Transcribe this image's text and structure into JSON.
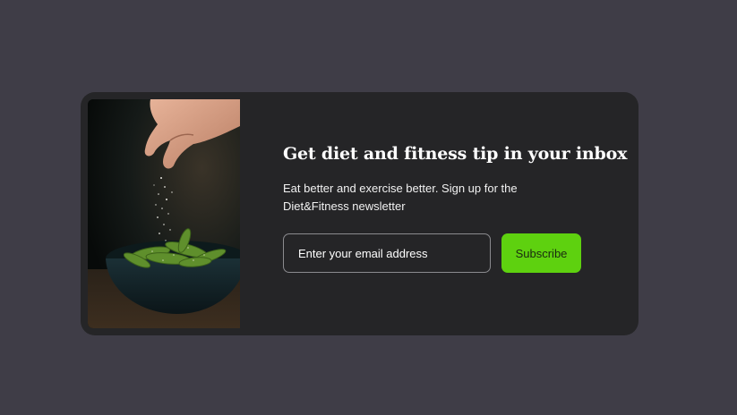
{
  "newsletter": {
    "title": "Get diet and fitness tip in your inbox",
    "description": "Eat better and exercise better. Sign up for the Diet&Fitness newsletter",
    "email_placeholder": "Enter your email address",
    "subscribe_label": "Subscribe"
  },
  "colors": {
    "page_background": "#3f3d47",
    "card_background": "#252527",
    "button_accent": "#5ed10f"
  },
  "image": {
    "subject": "hand sprinkling salt over a bowl of edamame"
  }
}
